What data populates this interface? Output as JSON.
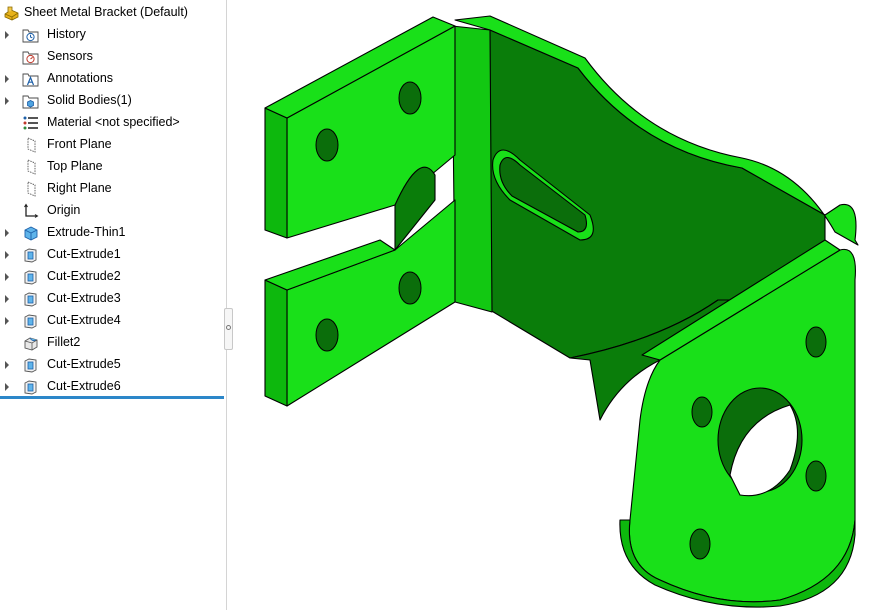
{
  "feature_tree": {
    "root": {
      "label": "Sheet Metal Bracket  (Default)",
      "icon": "part-icon"
    },
    "items": [
      {
        "label": "History",
        "icon": "history-folder-icon",
        "expandable": true
      },
      {
        "label": "Sensors",
        "icon": "sensors-folder-icon",
        "expandable": false
      },
      {
        "label": "Annotations",
        "icon": "annotations-folder-icon",
        "expandable": true
      },
      {
        "label": "Solid Bodies(1)",
        "icon": "solid-bodies-folder-icon",
        "expandable": true
      },
      {
        "label": "Material <not specified>",
        "icon": "material-icon",
        "expandable": false
      },
      {
        "label": "Front Plane",
        "icon": "plane-icon",
        "expandable": false
      },
      {
        "label": "Top Plane",
        "icon": "plane-icon",
        "expandable": false
      },
      {
        "label": "Right Plane",
        "icon": "plane-icon",
        "expandable": false
      },
      {
        "label": "Origin",
        "icon": "origin-icon",
        "expandable": false
      },
      {
        "label": "Extrude-Thin1",
        "icon": "extrude-thin-icon",
        "expandable": true
      },
      {
        "label": "Cut-Extrude1",
        "icon": "cut-extrude-icon",
        "expandable": true
      },
      {
        "label": "Cut-Extrude2",
        "icon": "cut-extrude-icon",
        "expandable": true
      },
      {
        "label": "Cut-Extrude3",
        "icon": "cut-extrude-icon",
        "expandable": true
      },
      {
        "label": "Cut-Extrude4",
        "icon": "cut-extrude-icon",
        "expandable": true
      },
      {
        "label": "Fillet2",
        "icon": "fillet-icon",
        "expandable": false
      },
      {
        "label": "Cut-Extrude5",
        "icon": "cut-extrude-icon",
        "expandable": true
      },
      {
        "label": "Cut-Extrude6",
        "icon": "cut-extrude-icon",
        "expandable": true
      }
    ]
  },
  "viewport": {
    "model": "sheet-metal-bracket",
    "colors": {
      "face_light": "#19e019",
      "face_mid": "#0db80d",
      "face_dark": "#0a7d0a",
      "edge": "#000000",
      "hole_shadow": "#0b6e0b"
    }
  },
  "colors": {
    "rollback_bar": "#2c87c9",
    "panel_border": "#d4d4d4"
  }
}
